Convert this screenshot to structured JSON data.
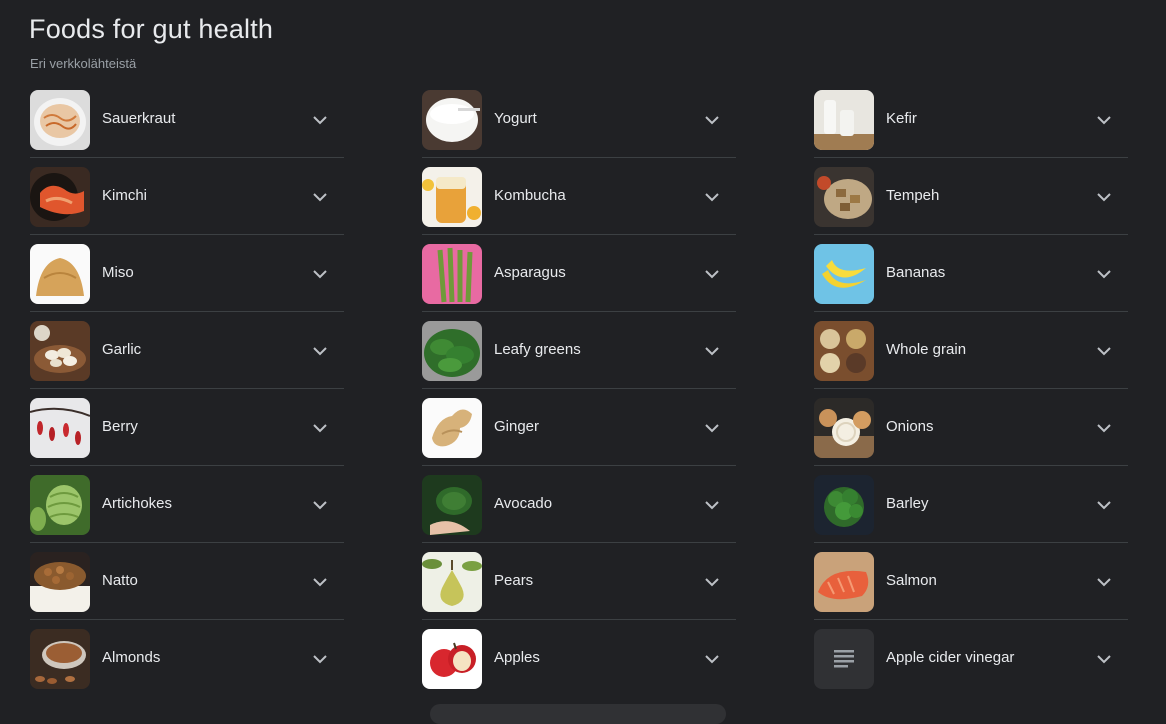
{
  "header": {
    "title": "Foods for gut health",
    "subtitle": "Eri verkkolähteistä"
  },
  "columns": [
    {
      "items": [
        {
          "label": "Sauerkraut",
          "icon": "sauerkraut-thumbnail"
        },
        {
          "label": "Kimchi",
          "icon": "kimchi-thumbnail"
        },
        {
          "label": "Miso",
          "icon": "miso-thumbnail"
        },
        {
          "label": "Garlic",
          "icon": "garlic-thumbnail"
        },
        {
          "label": "Berry",
          "icon": "berry-thumbnail"
        },
        {
          "label": "Artichokes",
          "icon": "artichokes-thumbnail"
        },
        {
          "label": "Natto",
          "icon": "natto-thumbnail"
        },
        {
          "label": "Almonds",
          "icon": "almonds-thumbnail"
        }
      ]
    },
    {
      "items": [
        {
          "label": "Yogurt",
          "icon": "yogurt-thumbnail"
        },
        {
          "label": "Kombucha",
          "icon": "kombucha-thumbnail"
        },
        {
          "label": "Asparagus",
          "icon": "asparagus-thumbnail"
        },
        {
          "label": "Leafy greens",
          "icon": "leafy-greens-thumbnail"
        },
        {
          "label": "Ginger",
          "icon": "ginger-thumbnail"
        },
        {
          "label": "Avocado",
          "icon": "avocado-thumbnail"
        },
        {
          "label": "Pears",
          "icon": "pears-thumbnail"
        },
        {
          "label": "Apples",
          "icon": "apples-thumbnail"
        }
      ]
    },
    {
      "items": [
        {
          "label": "Kefir",
          "icon": "kefir-thumbnail"
        },
        {
          "label": "Tempeh",
          "icon": "tempeh-thumbnail"
        },
        {
          "label": "Bananas",
          "icon": "bananas-thumbnail"
        },
        {
          "label": "Whole grain",
          "icon": "whole-grain-thumbnail"
        },
        {
          "label": "Onions",
          "icon": "onions-thumbnail"
        },
        {
          "label": "Barley",
          "icon": "barley-thumbnail"
        },
        {
          "label": "Salmon",
          "icon": "salmon-thumbnail"
        },
        {
          "label": "Apple cider vinegar",
          "icon": "text-lines-icon"
        }
      ]
    }
  ],
  "colors": {
    "background": "#202124",
    "text": "#e8eaed",
    "muted": "#9aa0a6",
    "divider": "#3c4043"
  }
}
